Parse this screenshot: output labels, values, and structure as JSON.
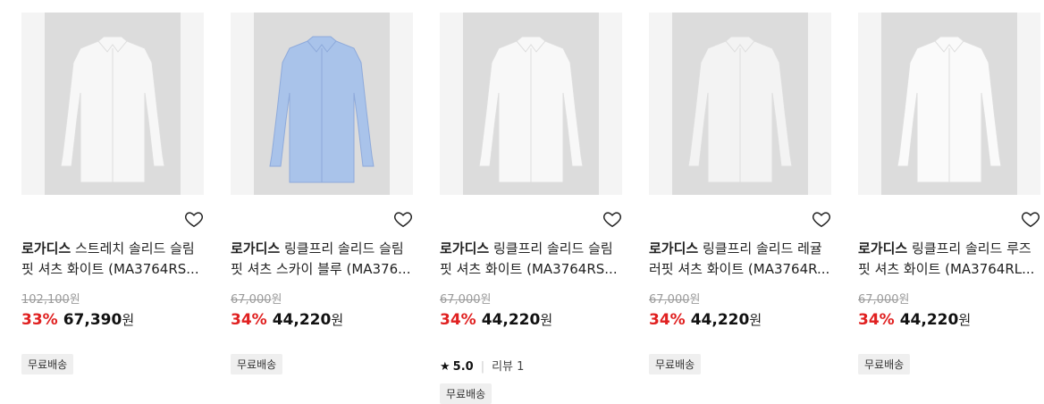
{
  "products": [
    {
      "brand": "로가디스",
      "name_line1_rest": " 스트레치 솔리드 슬림",
      "name_line2": "핏 셔츠 화이트 (MA3764RS...",
      "original_price": "102,100",
      "discount": "33%",
      "price": "67,390",
      "currency": "원",
      "tag": "무료배송",
      "shirt_color": "#f7f7f7"
    },
    {
      "brand": "로가디스",
      "name_line1_rest": " 링클프리 솔리드 슬림",
      "name_line2": "핏 셔츠 스카이 블루 (MA376...",
      "original_price": "67,000",
      "discount": "34%",
      "price": "44,220",
      "currency": "원",
      "tag": "무료배송",
      "shirt_color": "#a9c3ea"
    },
    {
      "brand": "로가디스",
      "name_line1_rest": " 링클프리 솔리드 슬림",
      "name_line2": "핏 셔츠 화이트 (MA3764RS...",
      "original_price": "67,000",
      "discount": "34%",
      "price": "44,220",
      "currency": "원",
      "rating": "5.0",
      "review_label": "리뷰 1",
      "tag": "무료배송",
      "shirt_color": "#f8f8f8"
    },
    {
      "brand": "로가디스",
      "name_line1_rest": " 링클프리 솔리드 레귤",
      "name_line2": "러핏 셔츠 화이트 (MA3764R...",
      "original_price": "67,000",
      "discount": "34%",
      "price": "44,220",
      "currency": "원",
      "tag": "무료배송",
      "shirt_color": "#f3f3f3"
    },
    {
      "brand": "로가디스",
      "name_line1_rest": " 링클프리 솔리드 루즈",
      "name_line2": "핏 셔츠 화이트 (MA3764RL...",
      "original_price": "67,000",
      "discount": "34%",
      "price": "44,220",
      "currency": "원",
      "tag": "무료배송",
      "shirt_color": "#fafafa"
    }
  ],
  "colors": {
    "discount": "#e02020",
    "original_price": "#9b9b9b",
    "image_bg": "#dcdcdc"
  }
}
